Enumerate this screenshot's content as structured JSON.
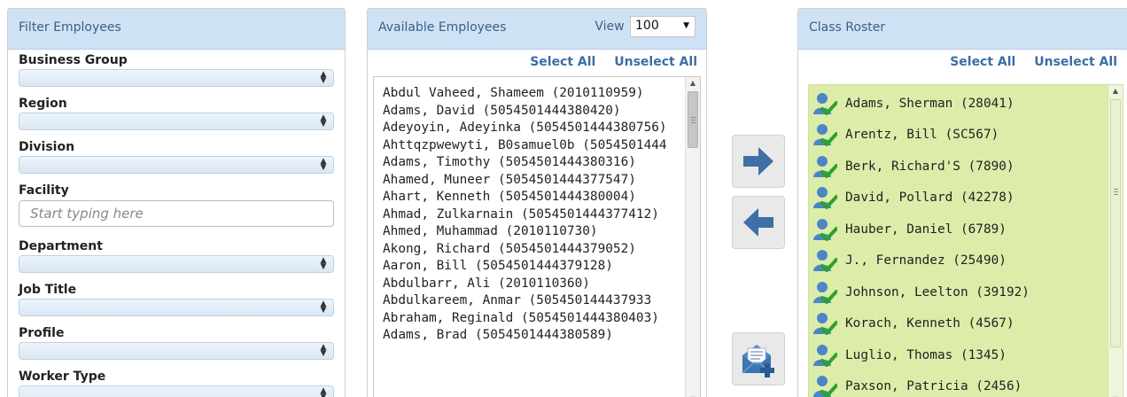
{
  "filter": {
    "title": "Filter Employees",
    "fields": [
      {
        "label": "Business Group",
        "type": "select"
      },
      {
        "label": "Region",
        "type": "select"
      },
      {
        "label": "Division",
        "type": "select"
      },
      {
        "label": "Facility",
        "type": "text",
        "placeholder": "Start typing here"
      },
      {
        "label": "Department",
        "type": "select"
      },
      {
        "label": "Job Title",
        "type": "select"
      },
      {
        "label": "Profile",
        "type": "select"
      },
      {
        "label": "Worker Type",
        "type": "select"
      }
    ]
  },
  "available": {
    "title": "Available Employees",
    "view_label": "View",
    "view_value": "100",
    "select_all": "Select All",
    "unselect_all": "Unselect All",
    "employees": [
      "Abdul Vaheed, Shameem (2010110959)",
      "Adams, David (5054501444380420)",
      "Adeyoyin, Adeyinka (5054501444380756)",
      "Ahttqzpwewyti, B0samuel0b (5054501444",
      "Adams, Timothy (5054501444380316)",
      "Ahamed, Muneer (5054501444377547)",
      "Ahart, Kenneth (5054501444380004)",
      "Ahmad, Zulkarnain (5054501444377412)",
      "Ahmed, Muhammad (2010110730)",
      "Akong, Richard (5054501444379052)",
      "Aaron, Bill (5054501444379128)",
      "Abdulbarr, Ali (2010110360)",
      "Abdulkareem, Anmar (505450144437933",
      "Abraham, Reginald (5054501444380403)",
      "Adams, Brad (5054501444380589)"
    ]
  },
  "roster": {
    "title": "Class Roster",
    "select_all": "Select All",
    "unselect_all": "Unselect All",
    "members": [
      "Adams, Sherman (28041)",
      "Arentz, Bill (SC567)",
      "Berk, Richard'S (7890)",
      "David, Pollard (42278)",
      "Hauber, Daniel (6789)",
      "J., Fernandez (25490)",
      "Johnson, Leelton (39192)",
      "Korach, Kenneth (4567)",
      "Luglio, Thomas (1345)",
      "Paxson, Patricia (2456)"
    ]
  },
  "buttons": {
    "add_icon": "arrow-right-icon",
    "remove_icon": "arrow-left-icon",
    "email_icon": "email-add-icon"
  },
  "colors": {
    "header_bg": "#cfe2f5",
    "header_text": "#3a5f86",
    "link": "#3b6ea5",
    "roster_bg": "#dcedaa",
    "arrow": "#3e6fa6",
    "check": "#2aa32a",
    "user": "#4a86c8"
  }
}
